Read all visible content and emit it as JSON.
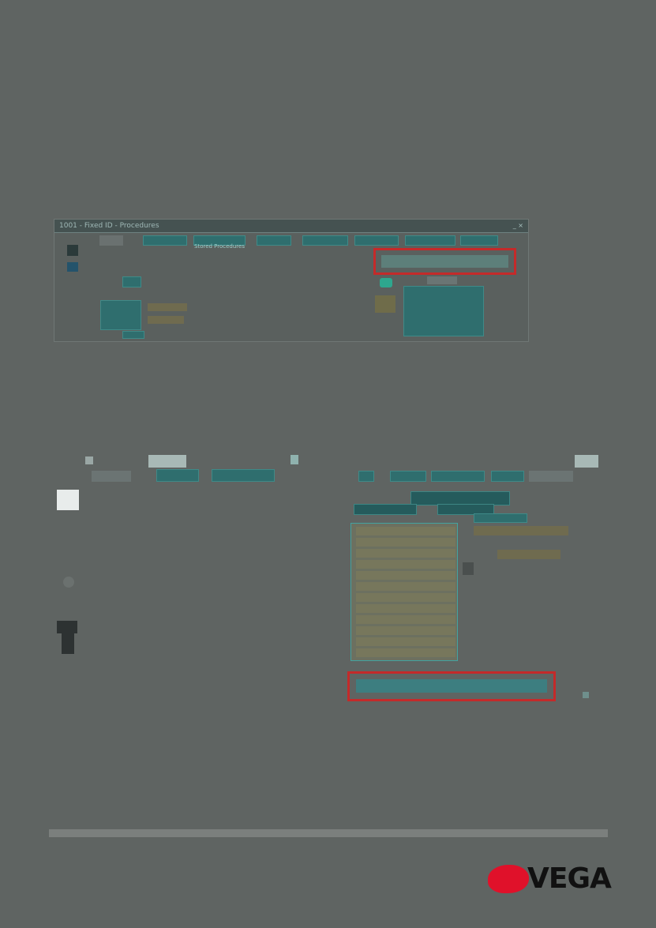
{
  "window": {
    "title": "1001 - Fixed ID - Procedures",
    "controls": "_ ×",
    "menu": [
      "",
      "",
      "Stored Procedures",
      "",
      "",
      "",
      "",
      ""
    ],
    "highlight_text": "",
    "left_caption": [
      "",
      ""
    ],
    "left_small_button": ""
  },
  "right_panel": {
    "tabs": [
      "",
      "",
      "",
      "",
      ""
    ],
    "toolbar_labels": [
      "",
      "",
      ""
    ],
    "list_rows": [
      "",
      "",
      "",
      "",
      "",
      "",
      "",
      "",
      "",
      "",
      "",
      "",
      ""
    ],
    "side_labels": [
      "",
      ""
    ],
    "highlight_text": ""
  },
  "left_panel": {
    "tabs": [
      "",
      "",
      ""
    ]
  },
  "logo": {
    "text": "VEGA",
    "brand_color": "#e0112a"
  },
  "colors": {
    "background": "#5f6462",
    "highlight_border": "#c42a2a",
    "accent_teal": "#2f6e6e"
  }
}
